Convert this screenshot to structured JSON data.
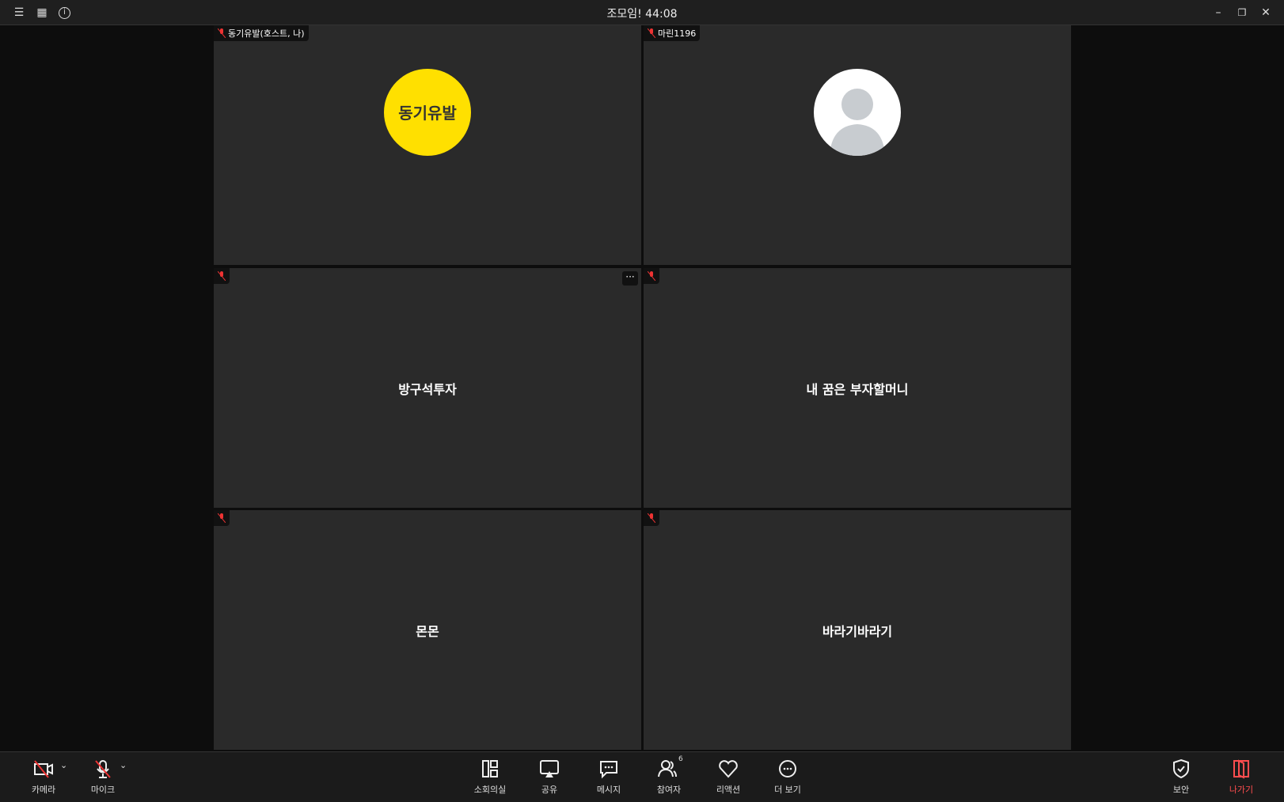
{
  "window": {
    "title": "조모임! 44:08"
  },
  "tiles": [
    {
      "name": "동기유발(호스트, 나)",
      "avatar_text": "동기유발",
      "avatar_color": "#ffe000"
    },
    {
      "name": "마린1196"
    },
    {
      "display_name": "방구석투자"
    },
    {
      "display_name": "내 꿈은 부자할머니"
    },
    {
      "display_name": "몬몬"
    },
    {
      "display_name": "바라기바라기"
    }
  ],
  "toolbar": {
    "camera": "카메라",
    "mic": "마이크",
    "breakout": "소회의실",
    "share": "공유",
    "chat": "메시지",
    "participants": "참여자",
    "participants_count": "6",
    "reactions": "리액션",
    "more": "더 보기",
    "security": "보안",
    "leave": "나가기",
    "leave_color": "#ff4d4f"
  }
}
